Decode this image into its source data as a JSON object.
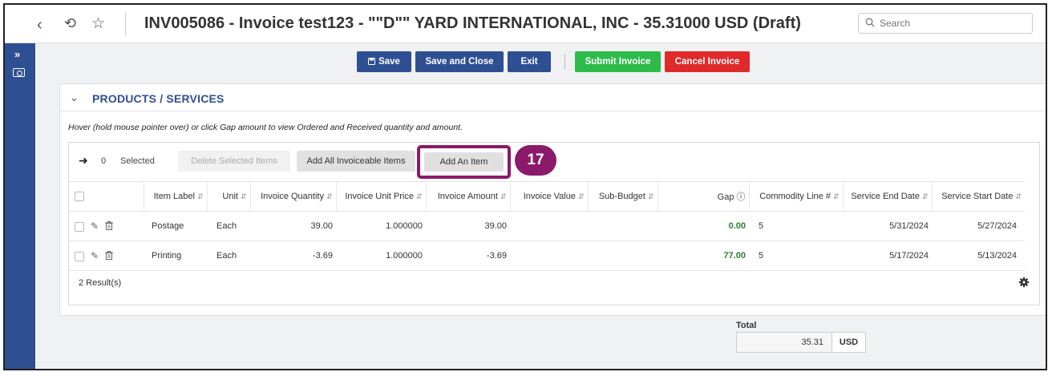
{
  "header": {
    "title": "INV005086 - Invoice test123 - \"\"D\"\" YARD INTERNATIONAL, INC - 35.31000 USD (Draft)",
    "search_placeholder": "Search",
    "icons": [
      "chevron-left-icon",
      "history-icon",
      "star-icon",
      "search-icon"
    ]
  },
  "sidebar": {
    "icons": [
      "expand-icon",
      "camera-icon"
    ]
  },
  "toolbar": {
    "save": "Save",
    "save_and_close": "Save and Close",
    "exit": "Exit",
    "submit_invoice": "Submit Invoice",
    "cancel_invoice": "Cancel Invoice"
  },
  "colors": {
    "primary": "#2f4f93",
    "submit": "#2dbc4a",
    "cancel": "#e02a2a",
    "annotation": "#8b1a6b",
    "gap_positive": "#2e7d32"
  },
  "section": {
    "title": "PRODUCTS / SERVICES",
    "hint": "Hover (hold mouse pointer over) or click Gap amount to view Ordered and Received quantity and amount."
  },
  "grid": {
    "selected_count": "0",
    "selected_label": "Selected",
    "delete_selected": "Delete Selected Items",
    "add_all_invoiceable": "Add All Invoiceable Items",
    "add_an_item": "Add An Item",
    "annotation_step": "17",
    "columns": [
      "Item Label",
      "Unit",
      "Invoice Quantity",
      "Invoice Unit Price",
      "Invoice Amount",
      "Invoice Value",
      "Sub-Budget",
      "Gap",
      "Commodity Line #",
      "Service End Date",
      "Service Start Date"
    ],
    "rows": [
      {
        "item_label": "Postage",
        "unit": "Each",
        "invoice_quantity": "39.00",
        "invoice_unit_price": "1.000000",
        "invoice_amount": "39.00",
        "invoice_value": "",
        "sub_budget": "",
        "gap": "0.00",
        "commodity_line": "5",
        "service_end_date": "5/31/2024",
        "service_start_date": "5/27/2024"
      },
      {
        "item_label": "Printing",
        "unit": "Each",
        "invoice_quantity": "-3.69",
        "invoice_unit_price": "1.000000",
        "invoice_amount": "-3.69",
        "invoice_value": "",
        "sub_budget": "",
        "gap": "77.00",
        "commodity_line": "5",
        "service_end_date": "5/17/2024",
        "service_start_date": "5/13/2024"
      }
    ],
    "result_count": "2 Result(s)"
  },
  "total": {
    "label": "Total",
    "amount": "35.31",
    "currency": "USD"
  }
}
